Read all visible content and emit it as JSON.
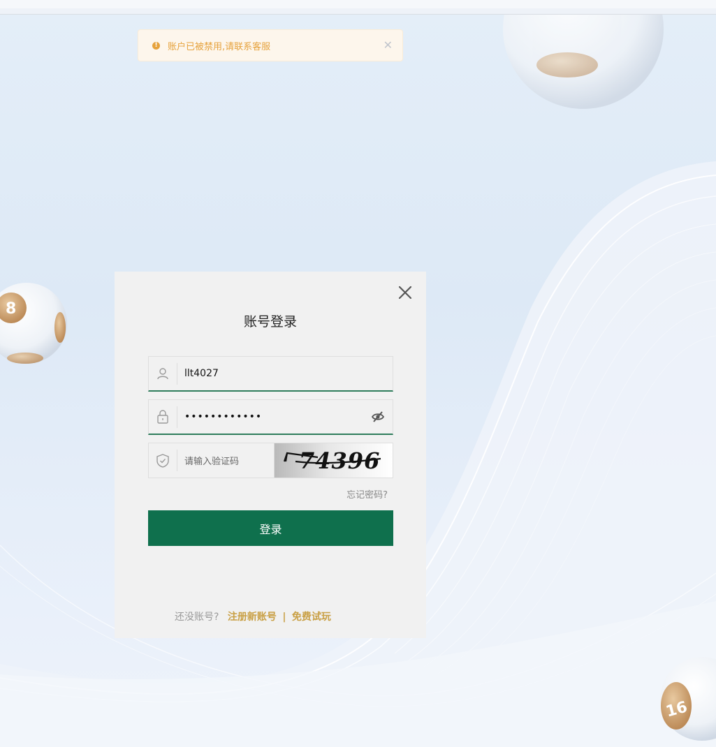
{
  "alert": {
    "message": "账户已被禁用,请联系客服",
    "icon": "warning-icon",
    "close_icon": "close-icon",
    "color": "#e6a23c"
  },
  "login": {
    "title": "账号登录",
    "username_value": "llt4027",
    "password_value": "••••••••••••",
    "captcha_placeholder": "请输入验证码",
    "captcha_text": "74396",
    "forgot_label": "忘记密码?",
    "submit_label": "登录",
    "no_account_label": "还没账号?",
    "register_label": "注册新账号",
    "separator": "|",
    "trial_label": "免费试玩",
    "accent": "#0f704d",
    "link_color": "#c9a045"
  },
  "balls": {
    "left_ball_number": "8",
    "right_ball_number": "16"
  }
}
